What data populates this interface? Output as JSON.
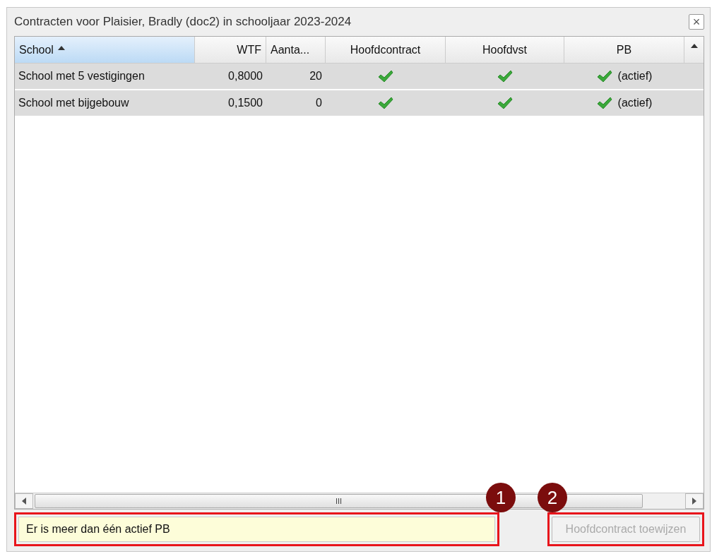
{
  "window": {
    "title": "Contracten voor Plaisier, Bradly (doc2) in schooljaar 2023-2024",
    "close": "×"
  },
  "table": {
    "columns": [
      {
        "label": "School",
        "sorted": true
      },
      {
        "label": "WTF",
        "sorted": false
      },
      {
        "label": "Aanta...",
        "sorted": false
      },
      {
        "label": "Hoofdcontract",
        "sorted": false
      },
      {
        "label": "Hoofdvst",
        "sorted": false
      },
      {
        "label": "PB",
        "sorted": false
      }
    ],
    "rows": [
      {
        "school": "School met 5 vestigingen",
        "wtf": "0,8000",
        "aantal": "20",
        "hoofdcontract": true,
        "hoofdvst": true,
        "pb": true,
        "pb_status": "(actief)"
      },
      {
        "school": "School met bijgebouw",
        "wtf": "0,1500",
        "aantal": "0",
        "hoofdcontract": true,
        "hoofdvst": true,
        "pb": true,
        "pb_status": "(actief)"
      }
    ],
    "scrollbar_grip": "III"
  },
  "message": "Er is meer dan één actief PB",
  "button": {
    "label": "Hoofdcontract toewijzen",
    "disabled": true
  },
  "callouts": [
    "1",
    "2"
  ]
}
